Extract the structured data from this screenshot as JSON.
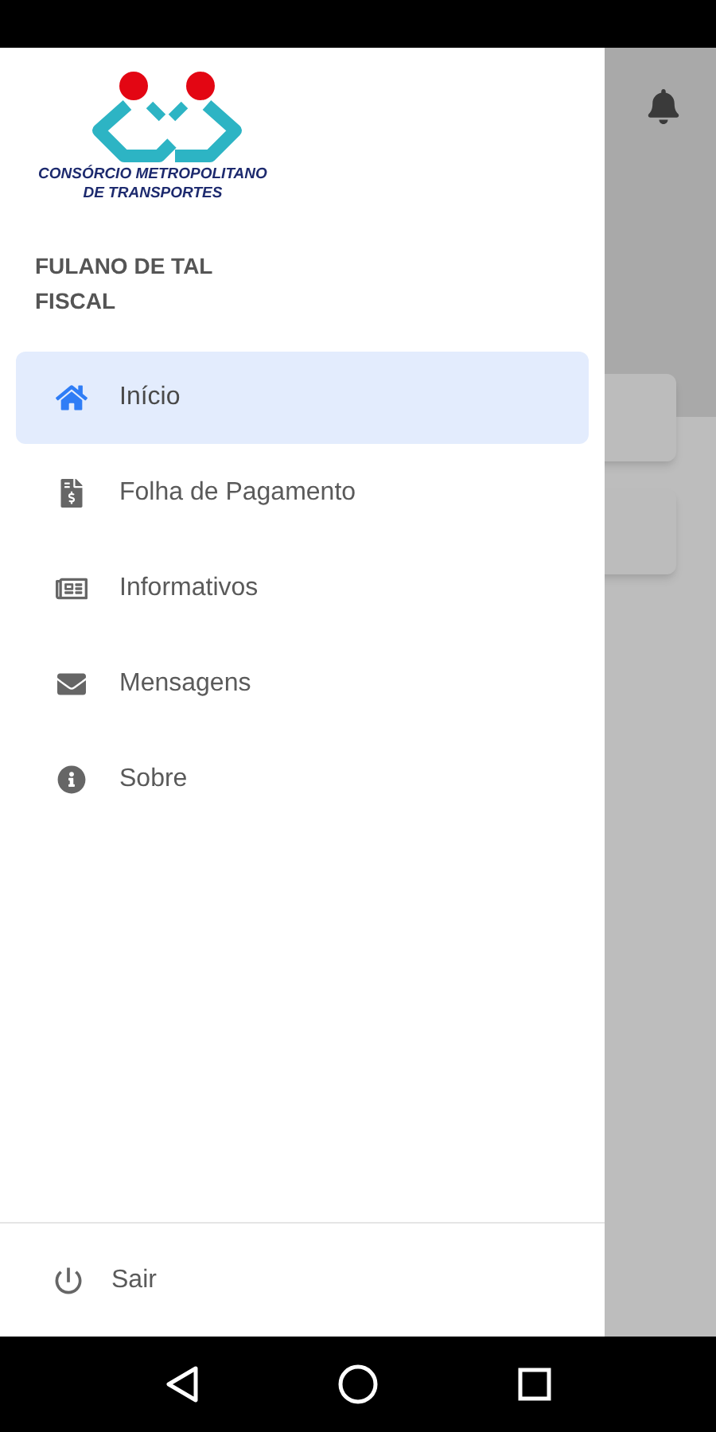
{
  "logo": {
    "line_1": "CONSÓRCIO METROPOLITANO",
    "line_2": "DE TRANSPORTES"
  },
  "user": {
    "name": "FULANO DE TAL",
    "role": "FISCAL"
  },
  "menu": [
    {
      "label": "Início",
      "selected": true
    },
    {
      "label": "Folha de Pagamento",
      "selected": false
    },
    {
      "label": "Informativos",
      "selected": false
    },
    {
      "label": "Mensagens",
      "selected": false
    },
    {
      "label": "Sobre",
      "selected": false
    }
  ],
  "footer": {
    "label": "Sair"
  }
}
